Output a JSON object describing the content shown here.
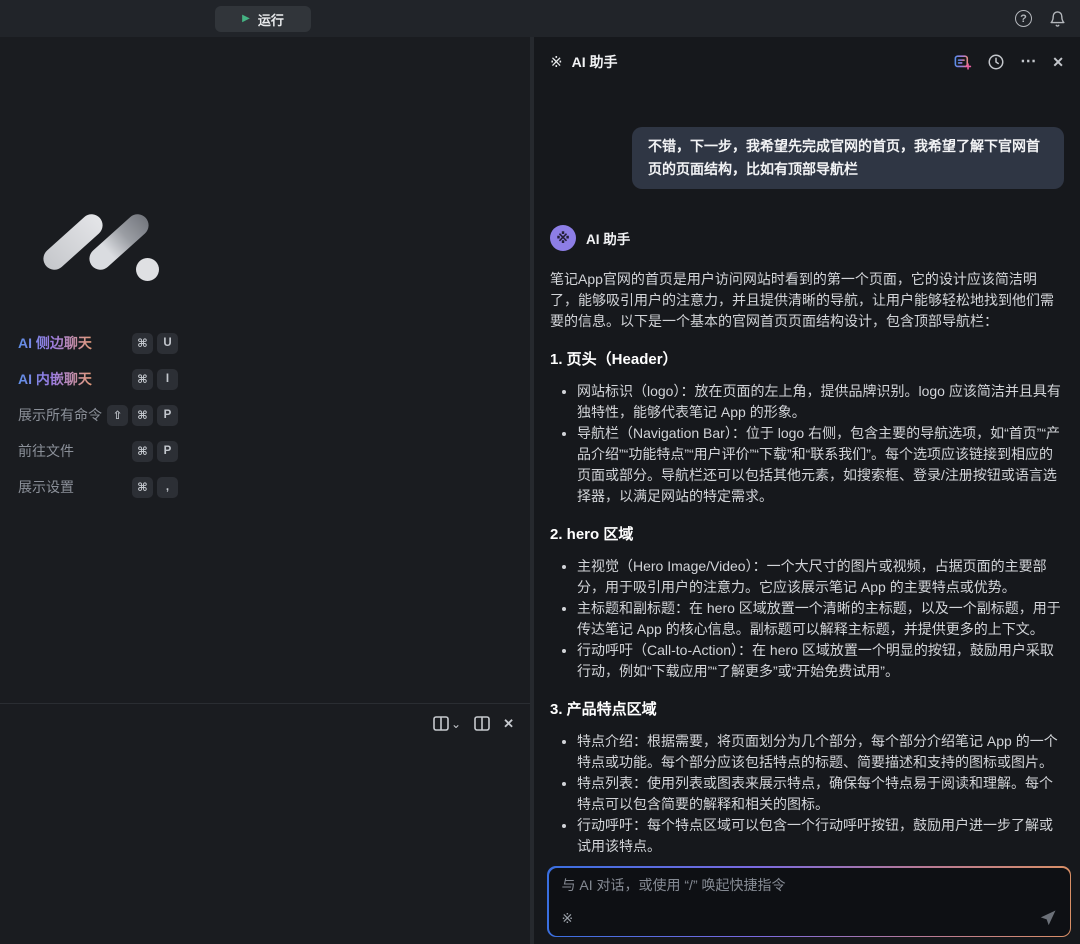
{
  "icons": {
    "play": "▶",
    "help": "?",
    "more": "⋯",
    "close": "✕",
    "chevron_down": "⌄",
    "sparkle": "※"
  },
  "topbar": {
    "run_label": "运行"
  },
  "left_menu": {
    "items": [
      {
        "label": "AI 侧边聊天",
        "keys": [
          "⌘",
          "U"
        ]
      },
      {
        "label": "AI 内嵌聊天",
        "keys": [
          "⌘",
          "I"
        ]
      },
      {
        "label": "展示所有命令",
        "keys": [
          "⇧",
          "⌘",
          "P"
        ]
      },
      {
        "label": "前往文件",
        "keys": [
          "⌘",
          "P"
        ]
      },
      {
        "label": "展示设置",
        "keys": [
          "⌘",
          ","
        ]
      }
    ]
  },
  "ai_panel": {
    "title": "AI 助手",
    "assistant_name": "AI 助手",
    "user_message": "不错，下一步，我希望先完成官网的首页，我希望了解下官网首页的页面结构，比如有顶部导航栏",
    "intro": "笔记App官网的首页是用户访问网站时看到的第一个页面，它的设计应该简洁明了，能够吸引用户的注意力，并且提供清晰的导航，让用户能够轻松地找到他们需要的信息。以下是一个基本的官网首页页面结构设计，包含顶部导航栏：",
    "sections": [
      {
        "heading": "1. 页头（Header）",
        "bullets": [
          "网站标识（logo）：放在页面的左上角，提供品牌识别。logo 应该简洁并且具有独特性，能够代表笔记 App 的形象。",
          "导航栏（Navigation Bar）：位于 logo 右侧，包含主要的导航选项，如“首页”“产品介绍”“功能特点”“用户评价”“下载”和“联系我们”。每个选项应该链接到相应的页面或部分。导航栏还可以包括其他元素，如搜索框、登录/注册按钮或语言选择器，以满足网站的特定需求。"
        ]
      },
      {
        "heading": "2. hero 区域",
        "bullets": [
          "主视觉（Hero Image/Video）：一个大尺寸的图片或视频，占据页面的主要部分，用于吸引用户的注意力。它应该展示笔记 App 的主要特点或优势。",
          "主标题和副标题：在 hero 区域放置一个清晰的主标题，以及一个副标题，用于传达笔记 App 的核心信息。副标题可以解释主标题，并提供更多的上下文。",
          "行动呼吁（Call-to-Action）：在 hero 区域放置一个明显的按钮，鼓励用户采取行动，例如“下载应用”“了解更多”或“开始免费试用”。"
        ]
      },
      {
        "heading": "3. 产品特点区域",
        "bullets": [
          "特点介绍：根据需要，将页面划分为几个部分，每个部分介绍笔记 App 的一个特点或功能。每个部分应该包括特点的标题、简要描述和支持的图标或图片。",
          "特点列表：使用列表或图表来展示特点，确保每个特点易于阅读和理解。每个特点可以包含简要的解释和相关的图标。",
          "行动呼吁：每个特点区域可以包含一个行动呼吁按钮，鼓励用户进一步了解或试用该特点。"
        ]
      }
    ],
    "input": {
      "placeholder": "与 AI 对话，或使用 “/” 唤起快捷指令"
    }
  },
  "colors": {
    "accent_green": "#45b383",
    "avatar_purple": "#8d7ee6",
    "gradient_blue": "#3a6fe0",
    "gradient_purple": "#7a6ae0",
    "gradient_orange": "#d98f66",
    "bubble_bg": "#2f3644"
  }
}
